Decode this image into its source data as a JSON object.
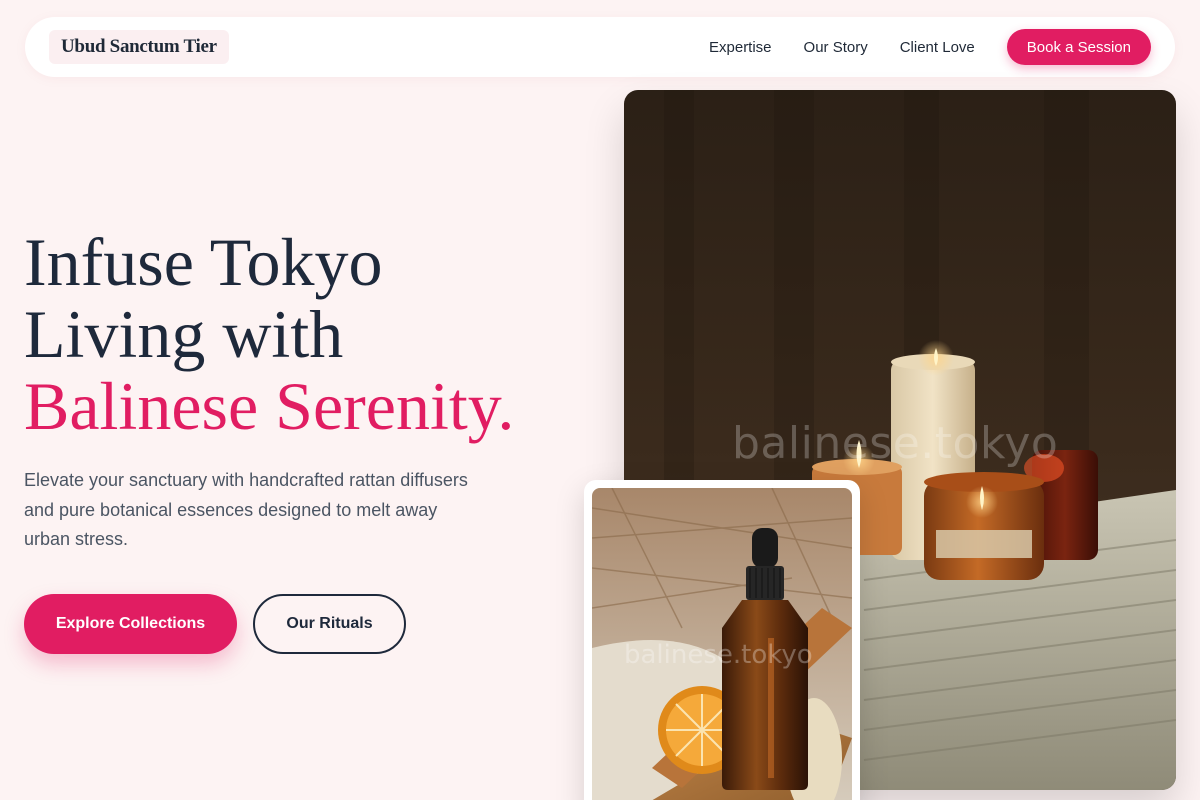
{
  "nav": {
    "brand": "Ubud Sanctum Tier",
    "links": [
      "Expertise",
      "Our Story",
      "Client Love"
    ],
    "cta": "Book a Session"
  },
  "hero": {
    "headline_line1": "Infuse Tokyo",
    "headline_line2": "Living with",
    "headline_accent": "Balinese Serenity.",
    "lede": "Elevate your sanctuary with handcrafted rattan diffusers and pure botanical essences designed to melt away urban stress.",
    "primary_button": "Explore Collections",
    "secondary_button": "Our Rituals"
  },
  "images": {
    "main_watermark": "balinese.tokyo",
    "inset_watermark": "balinese.tokyo"
  },
  "colors": {
    "accent": "#e11d62",
    "background": "#fdf3f3",
    "text": "#1e293b"
  }
}
